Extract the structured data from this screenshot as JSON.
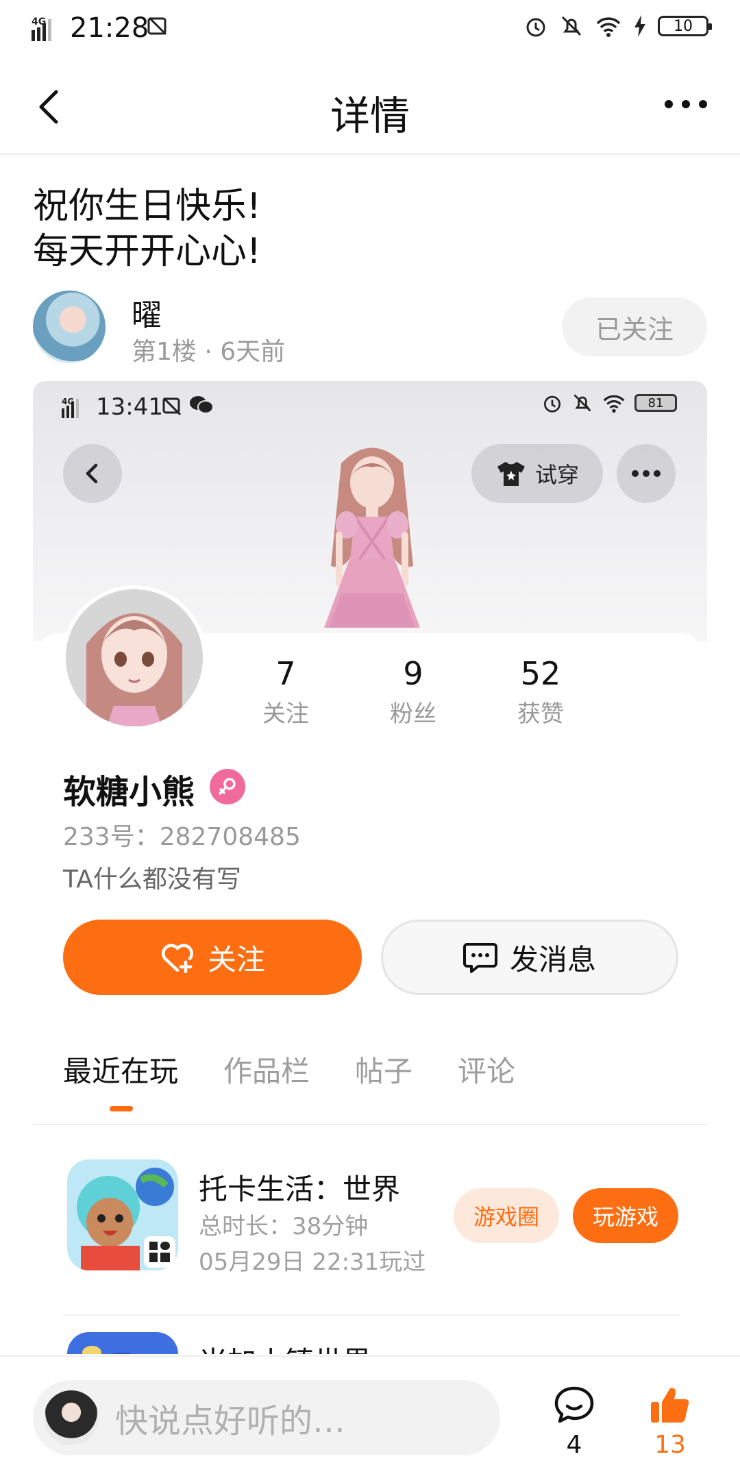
{
  "status_bar": {
    "network": "4G",
    "time": "21:28",
    "battery": "10"
  },
  "nav": {
    "title": "详情"
  },
  "post": {
    "lines": [
      "祝你生日快乐!",
      "每天开开心心!"
    ],
    "author": {
      "name": "曜",
      "meta": "第1楼 · 6天前",
      "follow_state": "已关注"
    }
  },
  "screenshot": {
    "status_bar": {
      "network": "4G",
      "time": "13:41",
      "battery": "81"
    },
    "tryon_label": "试穿",
    "profile": {
      "stats": [
        {
          "num": "7",
          "label": "关注"
        },
        {
          "num": "9",
          "label": "粉丝"
        },
        {
          "num": "52",
          "label": "获赞"
        }
      ],
      "nickname": "软糖小熊",
      "uid": "233号：282708485",
      "bio": "TA什么都没有写",
      "follow_label": "关注",
      "message_label": "发消息"
    },
    "tabs": [
      "最近在玩",
      "作品栏",
      "帖子",
      "评论"
    ],
    "games": [
      {
        "name": "托卡生活：世界",
        "duration": "总时长：38分钟",
        "last_played": "05月29日 22:31玩过",
        "circle_label": "游戏圈",
        "play_label": "玩游戏"
      },
      {
        "name": "米加小镇世界"
      }
    ]
  },
  "bottom": {
    "placeholder": "快说点好听的…",
    "comment_count": "4",
    "like_count": "13"
  },
  "colors": {
    "accent": "#fd6e13",
    "gender": "#f06a9a"
  }
}
